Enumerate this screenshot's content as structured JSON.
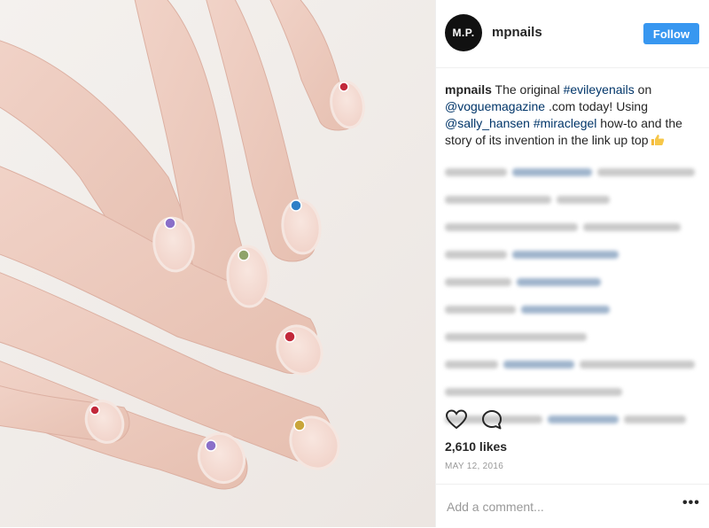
{
  "post": {
    "username": "mpnails",
    "avatar_text": "M.P.",
    "follow_label": "Follow",
    "caption": {
      "username": "mpnails",
      "text_1": " The original ",
      "hashtag_1": "#evileyenails",
      "text_2": " on ",
      "mention_1": "@voguemagazine",
      "text_3": " .com today! Using ",
      "mention_2": "@sally_hansen",
      "text_4": " ",
      "hashtag_2": "#miraclegel",
      "text_5": " how-to and the story of its invention in the link up top",
      "emoji": "thumbs-up-emoji"
    },
    "likes": "2,610 likes",
    "date": "MAY 12, 2016",
    "comment_placeholder": "Add a comment...",
    "more_label": "•••"
  },
  "icons": {
    "like": "heart-icon",
    "comment": "comment-bubble-icon"
  },
  "colors": {
    "follow_button": "#3897f0",
    "link": "#003569",
    "gem_purple": "#8a6fc9",
    "gem_blue": "#2f7fc7",
    "gem_red": "#c2283a",
    "gem_green": "#8fa36a",
    "gem_gold": "#c9a53a"
  }
}
